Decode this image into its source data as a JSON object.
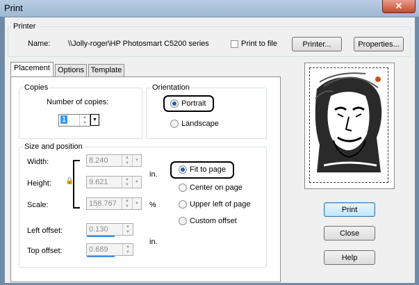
{
  "window": {
    "title": "Print",
    "close_glyph": "✕"
  },
  "printer": {
    "group_label": "Printer",
    "name_label": "Name:",
    "name_value": "\\\\Jolly-roger\\HP Photosmart C5200 series",
    "print_to_file_label": "Print to file",
    "print_to_file_checked": false,
    "printer_button": "Printer...",
    "properties_button": "Properties..."
  },
  "tabs": [
    {
      "label": "Placement",
      "active": true
    },
    {
      "label": "Options",
      "active": false
    },
    {
      "label": "Template",
      "active": false
    }
  ],
  "copies": {
    "group_label": "Copies",
    "number_label": "Number of copies:",
    "value": "1"
  },
  "orientation": {
    "group_label": "Orientation",
    "portrait": "Portrait",
    "landscape": "Landscape",
    "selected": "portrait"
  },
  "size_position": {
    "group_label": "Size and position",
    "width_label": "Width:",
    "width_value": "8.240",
    "height_label": "Height:",
    "height_value": "9.621",
    "scale_label": "Scale:",
    "scale_value": "158.767",
    "unit_in": "in.",
    "unit_pct": "%",
    "left_offset_label": "Left offset:",
    "left_offset_value": "0.130",
    "top_offset_label": "Top offset:",
    "top_offset_value": "0.689",
    "unit_in_offset": "in.",
    "fit_to_page": "Fit to page",
    "center_on_page": "Center on page",
    "upper_left": "Upper left of page",
    "custom_offset": "Custom offset",
    "selected": "fit_to_page"
  },
  "buttons": {
    "print": "Print",
    "close": "Close",
    "help": "Help"
  },
  "colors": {
    "accent": "#1d5fb5",
    "default_button_border": "#3c7fb1",
    "titlebar": "#b9cde3",
    "close": "#c9462c"
  }
}
